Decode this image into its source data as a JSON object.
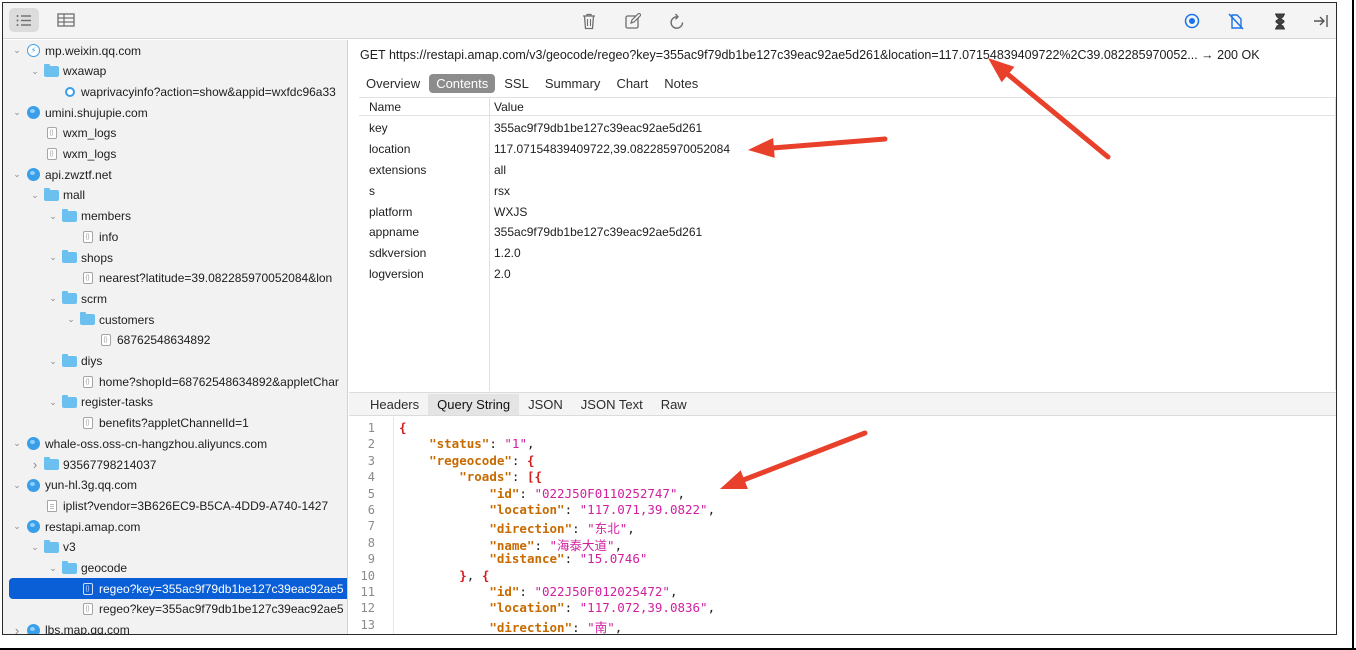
{
  "toolbar": {
    "icons": [
      "list-view-icon",
      "table-view-icon",
      "trash-icon",
      "edit-icon",
      "refresh-icon",
      "record-icon",
      "breakpoint-icon",
      "throttle-icon",
      "collapse-sidebar-icon"
    ],
    "accent_color": "#1a73e8"
  },
  "sidebar": {
    "rows": [
      {
        "label": "mp.weixin.qq.com",
        "icon": "bolt-icon",
        "expanded": true
      },
      {
        "label": "wxawap",
        "icon": "folder-icon",
        "expanded": true
      },
      {
        "label": "waprivacyinfo?action=show&appid=wxfdc96a33",
        "icon": "dot-icon"
      },
      {
        "label": "umini.shujupie.com",
        "icon": "globe-icon",
        "expanded": true
      },
      {
        "label": "wxm_logs",
        "icon": "file-icon"
      },
      {
        "label": "wxm_logs",
        "icon": "file-icon"
      },
      {
        "label": "api.zwztf.net",
        "icon": "globe-icon",
        "expanded": true
      },
      {
        "label": "mall",
        "icon": "folder-icon",
        "expanded": true
      },
      {
        "label": "members",
        "icon": "folder-icon",
        "expanded": true
      },
      {
        "label": "info",
        "icon": "file-icon"
      },
      {
        "label": "shops",
        "icon": "folder-icon",
        "expanded": true
      },
      {
        "label": "nearest?latitude=39.082285970052084&lon",
        "icon": "file-icon"
      },
      {
        "label": "scrm",
        "icon": "folder-icon",
        "expanded": true
      },
      {
        "label": "customers",
        "icon": "folder-icon",
        "expanded": true
      },
      {
        "label": "68762548634892",
        "icon": "file-icon"
      },
      {
        "label": "diys",
        "icon": "folder-icon",
        "expanded": true
      },
      {
        "label": "home?shopId=68762548634892&appletChar",
        "icon": "file-icon"
      },
      {
        "label": "register-tasks",
        "icon": "folder-icon",
        "expanded": true
      },
      {
        "label": "benefits?appletChannelId=1",
        "icon": "file-icon"
      },
      {
        "label": "whale-oss.oss-cn-hangzhou.aliyuncs.com",
        "icon": "globe-icon",
        "expanded": true
      },
      {
        "label": "93567798214037",
        "icon": "folder-icon",
        "expanded": false
      },
      {
        "label": "yun-hl.3g.qq.com",
        "icon": "globe-icon",
        "expanded": true
      },
      {
        "label": "iplist?vendor=3B626EC9-B5CA-4DD9-A740-1427",
        "icon": "doc-icon"
      },
      {
        "label": "restapi.amap.com",
        "icon": "globe-icon",
        "expanded": true
      },
      {
        "label": "v3",
        "icon": "folder-icon",
        "expanded": true
      },
      {
        "label": "geocode",
        "icon": "folder-icon",
        "expanded": true
      },
      {
        "label": "regeo?key=355ac9f79db1be127c39eac92ae5",
        "icon": "file-icon",
        "selected": true
      },
      {
        "label": "regeo?key=355ac9f79db1be127c39eac92ae5",
        "icon": "file-icon"
      },
      {
        "label": "lbs.map.qq.com",
        "icon": "globe-icon",
        "expanded": false
      }
    ],
    "selected_color": "#0a5fd6"
  },
  "request": {
    "url_line": "GET https://restapi.amap.com/v3/geocode/regeo?key=355ac9f79db1be127c39eac92ae5d261&location=117.07154839409722%2C39.082285970052... → 200 OK"
  },
  "top_tabs": [
    "Overview",
    "Contents",
    "SSL",
    "Summary",
    "Chart",
    "Notes"
  ],
  "query_table": {
    "headers": [
      "Name",
      "Value"
    ],
    "rows": [
      {
        "name": "key",
        "value": "355ac9f79db1be127c39eac92ae5d261"
      },
      {
        "name": "location",
        "value": "117.07154839409722,39.082285970052084"
      },
      {
        "name": "extensions",
        "value": "all"
      },
      {
        "name": "s",
        "value": "rsx"
      },
      {
        "name": "platform",
        "value": "WXJS"
      },
      {
        "name": "appname",
        "value": "355ac9f79db1be127c39eac92ae5d261"
      },
      {
        "name": "sdkversion",
        "value": "1.2.0"
      },
      {
        "name": "logversion",
        "value": "2.0"
      }
    ]
  },
  "bottom_tabs": [
    "Headers",
    "Query String",
    "JSON",
    "JSON Text",
    "Raw"
  ],
  "json_view": {
    "line_numbers": [
      "1",
      "2",
      "3",
      "4",
      "5",
      "6",
      "7",
      "8",
      "9",
      "10",
      "11",
      "12",
      "13"
    ],
    "lines": [
      [
        [
          "p",
          "{"
        ]
      ],
      [
        [
          "s",
          "    "
        ],
        [
          "k",
          "\"status\""
        ],
        [
          "t",
          ": "
        ],
        [
          "v",
          "\"1\""
        ],
        [
          "t",
          ","
        ]
      ],
      [
        [
          "s",
          "    "
        ],
        [
          "k",
          "\"regeocode\""
        ],
        [
          "t",
          ": "
        ],
        [
          "p",
          "{"
        ]
      ],
      [
        [
          "s",
          "        "
        ],
        [
          "k",
          "\"roads\""
        ],
        [
          "t",
          ": "
        ],
        [
          "p",
          "[{"
        ]
      ],
      [
        [
          "s",
          "            "
        ],
        [
          "k",
          "\"id\""
        ],
        [
          "t",
          ": "
        ],
        [
          "v",
          "\"022J50F0110252747\""
        ],
        [
          "t",
          ","
        ]
      ],
      [
        [
          "s",
          "            "
        ],
        [
          "k",
          "\"location\""
        ],
        [
          "t",
          ": "
        ],
        [
          "v",
          "\"117.071,39.0822\""
        ],
        [
          "t",
          ","
        ]
      ],
      [
        [
          "s",
          "            "
        ],
        [
          "k",
          "\"direction\""
        ],
        [
          "t",
          ": "
        ],
        [
          "v",
          "\"东北\""
        ],
        [
          "t",
          ","
        ]
      ],
      [
        [
          "s",
          "            "
        ],
        [
          "k",
          "\"name\""
        ],
        [
          "t",
          ": "
        ],
        [
          "v",
          "\"海泰大道\""
        ],
        [
          "t",
          ","
        ]
      ],
      [
        [
          "s",
          "            "
        ],
        [
          "k",
          "\"distance\""
        ],
        [
          "t",
          ": "
        ],
        [
          "v",
          "\"15.0746\""
        ]
      ],
      [
        [
          "s",
          "        "
        ],
        [
          "p",
          "}"
        ],
        [
          "t",
          ", "
        ],
        [
          "p",
          "{"
        ]
      ],
      [
        [
          "s",
          "            "
        ],
        [
          "k",
          "\"id\""
        ],
        [
          "t",
          ": "
        ],
        [
          "v",
          "\"022J50F012025472\""
        ],
        [
          "t",
          ","
        ]
      ],
      [
        [
          "s",
          "            "
        ],
        [
          "k",
          "\"location\""
        ],
        [
          "t",
          ": "
        ],
        [
          "v",
          "\"117.072,39.0836\""
        ],
        [
          "t",
          ","
        ]
      ],
      [
        [
          "s",
          "            "
        ],
        [
          "k",
          "\"direction\""
        ],
        [
          "t",
          ": "
        ],
        [
          "v",
          "\"南\""
        ],
        [
          "t",
          ","
        ]
      ]
    ]
  },
  "annotation_color": "#e8402a"
}
